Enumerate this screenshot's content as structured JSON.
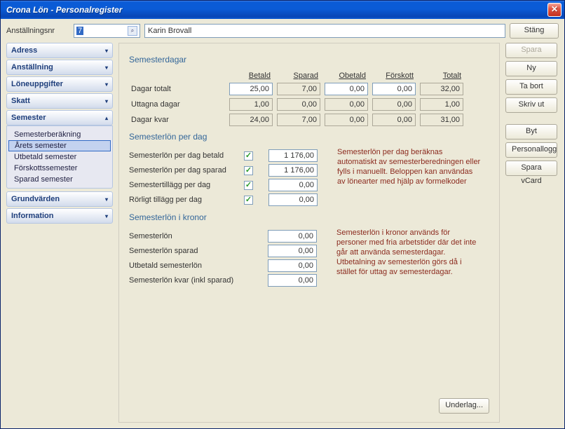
{
  "window": {
    "title": "Crona Lön - Personalregister"
  },
  "top": {
    "label": "Anställningsnr",
    "id_value": "7",
    "name_value": "Karin Brovall",
    "close_label": "Stäng"
  },
  "rightButtons": {
    "spara": "Spara",
    "ny": "Ny",
    "ta_bort": "Ta bort",
    "skriv_ut": "Skriv ut",
    "byt_nummer": "Byt nummer",
    "personallogg": "Personallogg",
    "spara_vcard": "Spara vCard"
  },
  "sidebar": {
    "adress": "Adress",
    "anstallning": "Anställning",
    "loneuppgifter": "Löneuppgifter",
    "skatt": "Skatt",
    "semester": "Semester",
    "semester_items": [
      "Semesterberäkning",
      "Årets semester",
      "Utbetald semester",
      "Förskottssemester",
      "Sparad semester"
    ],
    "grundvarden": "Grundvärden",
    "information": "Information"
  },
  "sections": {
    "dagar_title": "Semesterdagar",
    "cols": {
      "betald": "Betald",
      "sparad": "Sparad",
      "obetald": "Obetald",
      "forskott": "Förskott",
      "totalt": "Totalt"
    },
    "rows": {
      "totalt_label": "Dagar totalt",
      "uttagna_label": "Uttagna dagar",
      "kvar_label": "Dagar kvar"
    },
    "values": {
      "totalt": {
        "betald": "25,00",
        "sparad": "7,00",
        "obetald": "0,00",
        "forskott": "0,00",
        "totalt": "32,00"
      },
      "uttagna": {
        "betald": "1,00",
        "sparad": "0,00",
        "obetald": "0,00",
        "forskott": "0,00",
        "totalt": "1,00"
      },
      "kvar": {
        "betald": "24,00",
        "sparad": "7,00",
        "obetald": "0,00",
        "forskott": "0,00",
        "totalt": "31,00"
      }
    },
    "perday_title": "Semesterlön per dag",
    "perday": {
      "betald_label": "Semesterlön per dag betald",
      "betald_val": "1 176,00",
      "sparad_label": "Semesterlön per dag sparad",
      "sparad_val": "1 176,00",
      "tillagg_label": "Semestertillägg per dag",
      "tillagg_val": "0,00",
      "rorligt_label": "Rörligt tillägg per dag",
      "rorligt_val": "0,00"
    },
    "perday_help": "Semesterlön per dag beräknas automatiskt av semesterberedningen eller fylls i manuellt. Beloppen kan användas av lönearter med hjälp av formelkoder",
    "kronor_title": "Semesterlön i kronor",
    "kronor": {
      "a_label": "Semesterlön",
      "a_val": "0,00",
      "b_label": "Semesterlön sparad",
      "b_val": "0,00",
      "c_label": "Utbetald semesterlön",
      "c_val": "0,00",
      "d_label": "Semesterlön kvar (inkl sparad)",
      "d_val": "0,00"
    },
    "kronor_help": "Semesterlön i kronor används för personer med fria arbetstider där det inte går att använda semesterdagar. Utbetalning av semesterlön görs då i stället för uttag av semesterdagar.",
    "underlag": "Underlag..."
  }
}
